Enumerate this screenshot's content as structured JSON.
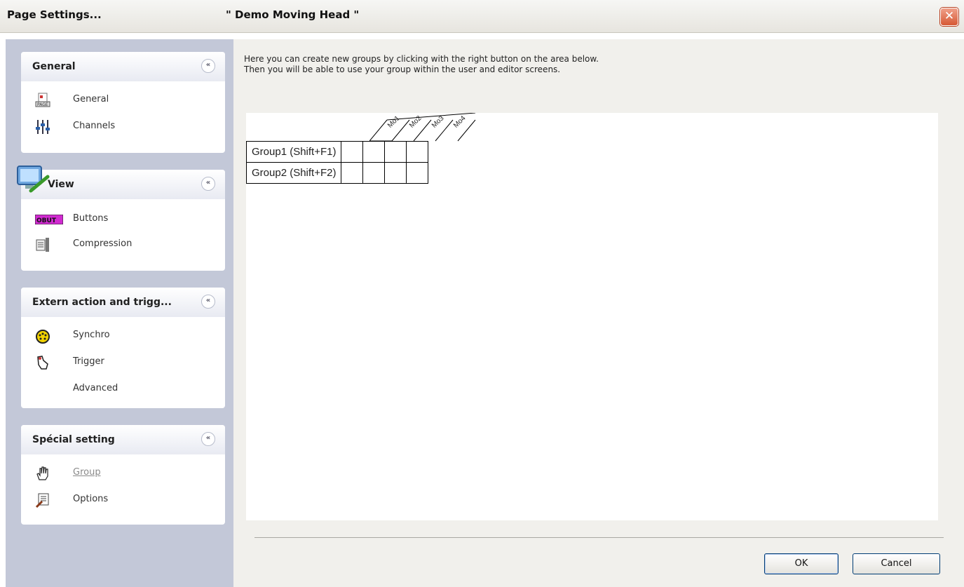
{
  "window": {
    "title": "Page  Settings...",
    "document_name": "\" Demo Moving Head \"",
    "close_symbol": "✕"
  },
  "sidebar": {
    "collapse_symbol": "«",
    "panels": [
      {
        "title": "General",
        "items": [
          {
            "label": "General",
            "icon": "page-icon"
          },
          {
            "label": "Channels",
            "icon": "sliders-icon"
          }
        ]
      },
      {
        "title": "View",
        "icon": "monitor-pencil-icon",
        "items": [
          {
            "label": "Buttons",
            "icon": "button-icon",
            "icon_text": "OBUT"
          },
          {
            "label": "Compression",
            "icon": "compression-icon"
          }
        ]
      },
      {
        "title": "Extern action and trigg...",
        "items": [
          {
            "label": "Synchro",
            "icon": "midi-connector-icon"
          },
          {
            "label": "Trigger",
            "icon": "trigger-hand-icon"
          },
          {
            "label": "Advanced",
            "icon": ""
          }
        ]
      },
      {
        "title": "Spécial setting",
        "items": [
          {
            "label": "Group",
            "icon": "hand-icon",
            "disabled": true
          },
          {
            "label": "Options",
            "icon": "options-icon"
          }
        ]
      }
    ]
  },
  "main": {
    "instructions": [
      "Here you can create new groups by clicking with the right button on the area below.",
      "Then you will be able to use your group within the user and editor screens."
    ],
    "group_table": {
      "columns": [
        "Mo1",
        "Mo2",
        "Mo3",
        "Mo4"
      ],
      "rows": [
        {
          "label": "Group1 (Shift+F1)"
        },
        {
          "label": "Group2 (Shift+F2)"
        }
      ]
    }
  },
  "buttons": {
    "ok": "OK",
    "cancel": "Cancel"
  }
}
